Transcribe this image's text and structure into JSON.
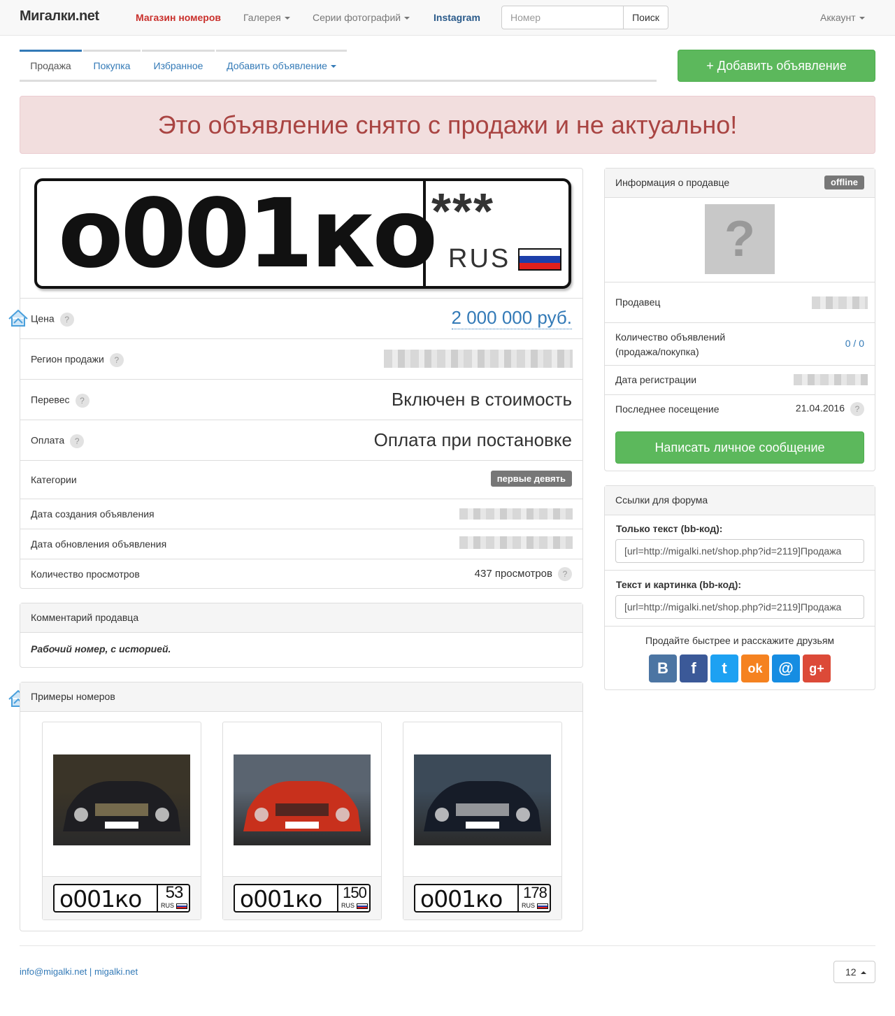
{
  "navbar": {
    "brand": "Мигалки.net",
    "shop": "Магазин номеров",
    "gallery": "Галерея",
    "series": "Серии фотографий",
    "instagram": "Instagram",
    "search_placeholder": "Номер",
    "search_button": "Поиск",
    "account": "Аккаунт"
  },
  "tabs": {
    "sale": "Продажа",
    "purchase": "Покупка",
    "favorites": "Избранное",
    "add": "Добавить объявление"
  },
  "add_button": "+ Добавить объявление",
  "alert": "Это объявление снято с продажи и не актуально!",
  "plate": {
    "number": "o001ко",
    "region": "***",
    "country": "RUS"
  },
  "details": {
    "price_label": "Цена",
    "price_value": "2 000 000 руб.",
    "region_label": "Регион продажи",
    "transfer_label": "Перевес",
    "transfer_value": "Включен в стоимость",
    "payment_label": "Оплата",
    "payment_value": "Оплата при постановке",
    "categories_label": "Категории",
    "category_badge": "первые девять",
    "created_label": "Дата создания объявления",
    "updated_label": "Дата обновления объявления",
    "views_label": "Количество просмотров",
    "views_value": "437 просмотров",
    "help": "?"
  },
  "comment": {
    "title": "Комментарий продавца",
    "text": "Рабочий номер, с историей."
  },
  "examples": {
    "title": "Примеры номеров",
    "items": [
      {
        "number": "o001ко",
        "region": "53",
        "country": "RUS"
      },
      {
        "number": "o001ко",
        "region": "150",
        "country": "RUS"
      },
      {
        "number": "o001ко",
        "region": "178",
        "country": "RUS"
      }
    ]
  },
  "seller": {
    "title": "Информация о продавце",
    "status": "offline",
    "avatar": "?",
    "seller_label": "Продавец",
    "count_label": "Количество объявлений (продажа/покупка)",
    "count_value": "0 / 0",
    "reg_label": "Дата регистрации",
    "last_label": "Последнее посещение",
    "last_value": "21.04.2016",
    "message_button": "Написать личное сообщение"
  },
  "forum": {
    "title": "Ссылки для форума",
    "text_label": "Только текст (bb-код):",
    "text_value": "[url=http://migalki.net/shop.php?id=2119]Продажа",
    "img_label": "Текст и картинка (bb-код):",
    "img_value": "[url=http://migalki.net/shop.php?id=2119]Продажа",
    "share_text": "Продайте быстрее и расскажите друзьям",
    "share": [
      {
        "icon": "vk-icon",
        "glyph": "B",
        "color": "#4c75a3"
      },
      {
        "icon": "facebook-icon",
        "glyph": "f",
        "color": "#3b5998"
      },
      {
        "icon": "twitter-icon",
        "glyph": "t",
        "color": "#1da1f2"
      },
      {
        "icon": "odnoklassniki-icon",
        "glyph": "ok",
        "color": "#f58220"
      },
      {
        "icon": "mailru-icon",
        "glyph": "@",
        "color": "#168de2"
      },
      {
        "icon": "googleplus-icon",
        "glyph": "g+",
        "color": "#dc4a38"
      }
    ]
  },
  "footer": {
    "email": "info@migalki.net",
    "separator": "|",
    "site": "migalki.net",
    "page": "12"
  }
}
